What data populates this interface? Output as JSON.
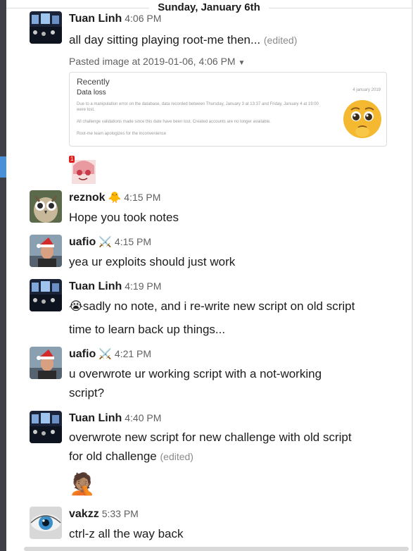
{
  "date_divider": "Sunday, January 6th",
  "messages": [
    {
      "author": "Tuan Linh",
      "time": "4:06 PM",
      "lines": [
        "all day sitting playing root-me then..."
      ],
      "edited": "(edited)",
      "attachment": {
        "label": "Pasted image at 2019-01-06, 4:06 PM",
        "preview": {
          "heading": "Recently",
          "subheading": "Data loss",
          "date": "4 january 2019",
          "lines": [
            "Due to a manipulation error on the database, data recorded between Thursday, January 3 at 13:37 and Friday, January 4 at 19:00",
            "were lost.",
            "All challenge validations made since this date have been lost. Created accounts are no longer available.",
            "Root-me team apologizes for the inconvenience"
          ]
        }
      }
    },
    {
      "author": "reznok",
      "badge_icon": "chick-emoji",
      "time": "4:15 PM",
      "lines": [
        "Hope you took notes"
      ]
    },
    {
      "author": "uafio",
      "badge_icon": "crossed-swords-emoji",
      "time": "4:15 PM",
      "lines": [
        "yea ur exploits should just work"
      ]
    },
    {
      "author": "Tuan Linh",
      "time": "4:19 PM",
      "lines": [
        "sadly no note, and i re-write new script on old script",
        "time to learn back up things..."
      ],
      "lead_icon": "crying-face-emoji"
    },
    {
      "author": "uafio",
      "badge_icon": "crossed-swords-emoji",
      "time": "4:21 PM",
      "lines": [
        "u overwrote ur working script with a not-working",
        "script?"
      ]
    },
    {
      "author": "Tuan Linh",
      "time": "4:40 PM",
      "lines": [
        "overwrote new script for new challenge with old script",
        "for old challenge"
      ],
      "edited": "(edited)"
    },
    {
      "author": "vakzz",
      "time": "5:33 PM",
      "lines": [
        "ctrl-z all the way back"
      ]
    }
  ],
  "notification_count": "1",
  "colors": {
    "sidebar": "#3f4047",
    "accent": "#4a90d9",
    "text": "#1d1c1d",
    "muted": "#616061"
  }
}
